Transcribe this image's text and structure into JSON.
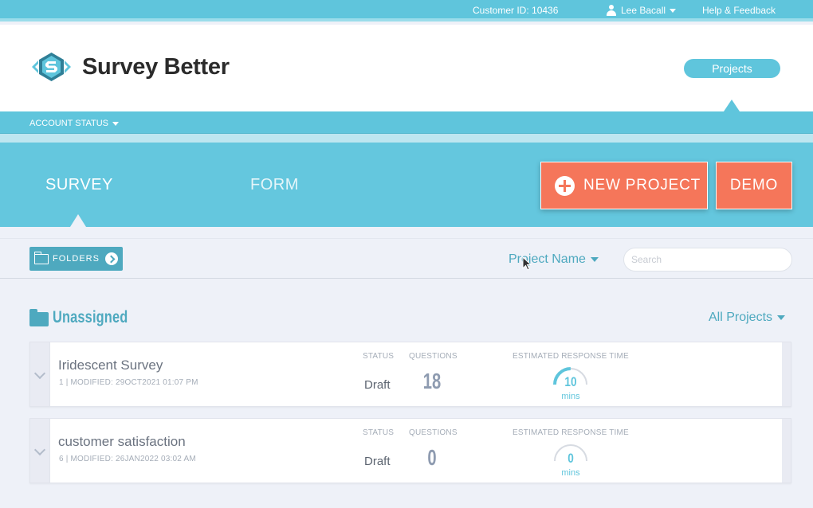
{
  "topbar": {
    "customer_id": "Customer ID: 10436",
    "user_name": "Lee Bacall",
    "help": "Help & Feedback"
  },
  "header": {
    "logo_text": "Survey Better",
    "projects_nav": "Projects"
  },
  "account_bar": {
    "label": "ACCOUNT STATUS"
  },
  "tabs": [
    {
      "label": "SURVEY",
      "active": true
    },
    {
      "label": "FORM",
      "active": false
    }
  ],
  "actions": {
    "new_project": "NEW PROJECT",
    "demo": "DEMO"
  },
  "toolbar": {
    "folders": "FOLDERS",
    "sort_by": "Project Name",
    "search_placeholder": "Search"
  },
  "section": {
    "title": "Unassigned",
    "filter": "All Projects"
  },
  "columns": {
    "status": "STATUS",
    "questions": "QUESTIONS",
    "ert": "ESTIMATED RESPONSE TIME"
  },
  "projects": [
    {
      "name": "Iridescent Survey",
      "meta": "1 | MODIFIED: 29OCT2021 01:07 PM",
      "status": "Draft",
      "questions": "18",
      "response_time": "10",
      "response_unit": "mins",
      "gauge_fraction": 0.5
    },
    {
      "name": "customer satisfaction",
      "meta": "6 | MODIFIED: 26JAN2022 03:02 AM",
      "status": "Draft",
      "questions": "0",
      "response_time": "0",
      "response_unit": "mins",
      "gauge_fraction": 0
    }
  ],
  "colors": {
    "brand_teal": "#5fc5dc",
    "accent_orange": "#f5765a",
    "dark_teal": "#4ea9bf"
  }
}
